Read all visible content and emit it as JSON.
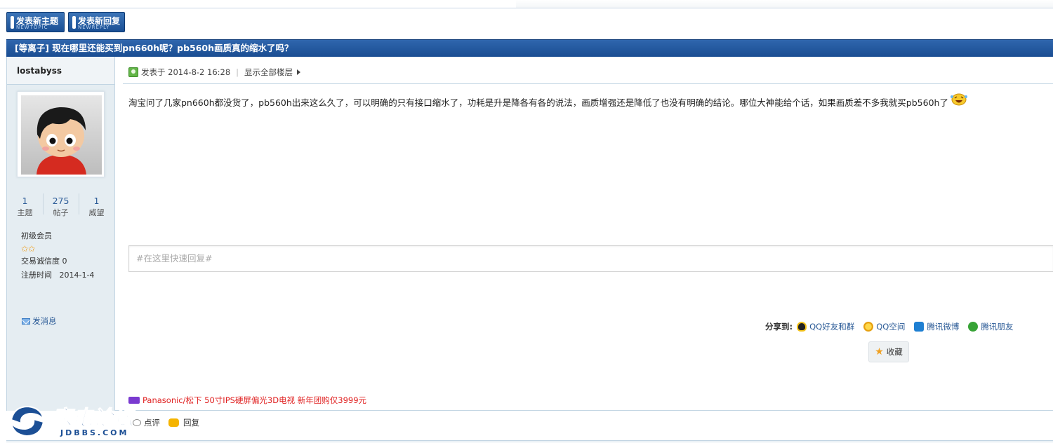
{
  "toolbar": {
    "new_topic": {
      "cn": "发表新主题",
      "en": "NEWTOPIC"
    },
    "new_reply": {
      "cn": "发表新回复",
      "en": "NEWREPLY"
    }
  },
  "thread": {
    "title": "[等离子] 现在哪里还能买到pn660h呢？pb560h画质真的缩水了吗？"
  },
  "author": {
    "name": "lostabyss",
    "stats": [
      {
        "num": "1",
        "label": "主题"
      },
      {
        "num": "275",
        "label": "帖子"
      },
      {
        "num": "1",
        "label": "威望"
      }
    ],
    "rank": "初级会员",
    "stars": "✩✩",
    "credit": "交易诚信度 0",
    "reg_label": "注册时间",
    "reg_date": "2014-1-4",
    "send_message": "发消息"
  },
  "post": {
    "posted_at": "发表于 2014-8-2 16:28",
    "separator": "|",
    "show_all": "显示全部楼层",
    "body": "淘宝问了几家pn660h都没货了，pb560h出来这么久了，可以明确的只有接口缩水了，功耗是升是降各有各的说法，画质增强还是降低了也没有明确的结论。哪位大神能给个话，如果画质差不多我就买pb560h了"
  },
  "quick_reply": {
    "placeholder": "#在这里快速回复#"
  },
  "share": {
    "label": "分享到:",
    "items": [
      {
        "label": "QQ好友和群",
        "icon": "qq-icon"
      },
      {
        "label": "QQ空间",
        "icon": "qzone-icon"
      },
      {
        "label": "腾讯微博",
        "icon": "tencent-weibo-icon"
      },
      {
        "label": "腾讯朋友",
        "icon": "tencent-pengyou-icon"
      }
    ]
  },
  "favorite": {
    "label": "收藏"
  },
  "ad": {
    "text": "Panasonic/松下 50寸IPS硬屏偏光3D电视 新年团购仅3999元"
  },
  "actions": {
    "comment": "点评",
    "reply": "回复"
  },
  "watermark": {
    "cn": "家电论坛",
    "en": "JDBBS.COM"
  },
  "colors": {
    "title_bar": "#1f5499",
    "sidebar_bg": "#e5edf2",
    "link": "#2b5b97",
    "ad_red": "#e02020",
    "border": "#c2d5e3"
  }
}
